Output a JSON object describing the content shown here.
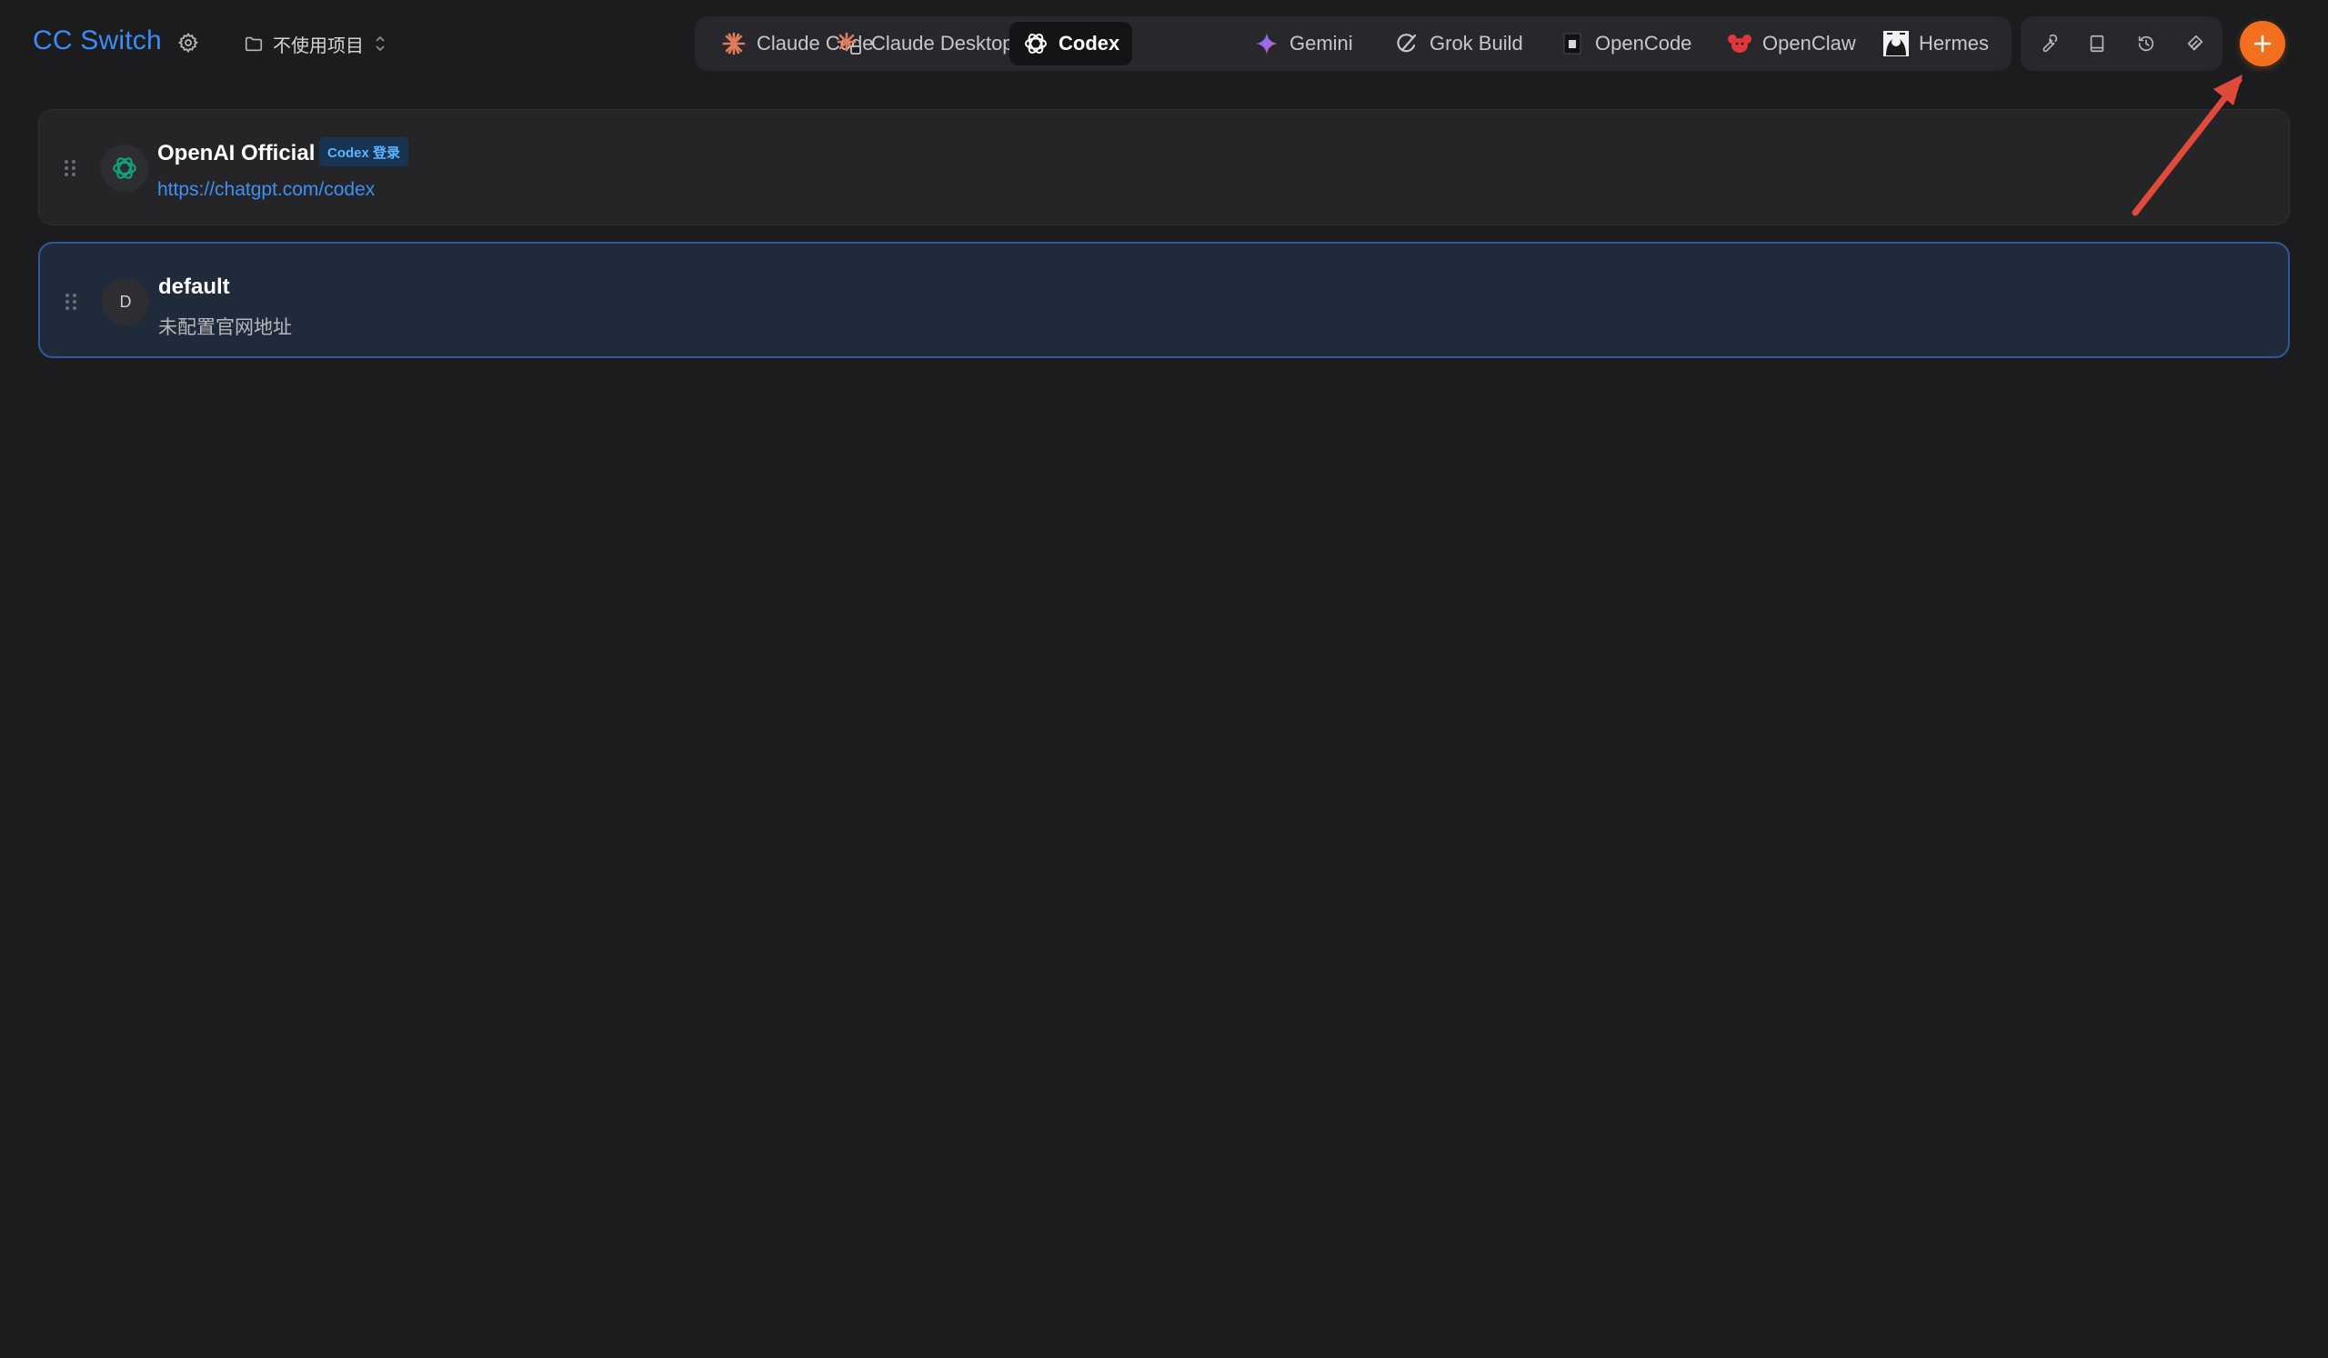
{
  "app": {
    "title": "CC Switch",
    "accent_color": "#3b8cf5",
    "add_button_color": "#f26f1d"
  },
  "header": {
    "settings_icon": "gear-icon",
    "project_selector": {
      "icon": "folder-icon",
      "value": "不使用项目",
      "caret_icon": "chevron-up-down-icon"
    }
  },
  "tabs": [
    {
      "label": "Claude Code",
      "icon": "claude-code-icon",
      "active": false
    },
    {
      "label": "Claude Desktop",
      "icon": "claude-desktop-icon",
      "active": false
    },
    {
      "label": "Codex",
      "icon": "openai-icon",
      "active": true
    },
    {
      "label": "Gemini",
      "icon": "gemini-icon",
      "active": false
    },
    {
      "label": "Grok Build",
      "icon": "grok-icon",
      "active": false
    },
    {
      "label": "OpenCode",
      "icon": "opencode-icon",
      "active": false
    },
    {
      "label": "OpenClaw",
      "icon": "openclaw-icon",
      "active": false
    },
    {
      "label": "Hermes",
      "icon": "hermes-icon",
      "active": false
    }
  ],
  "tools": [
    "wrench-icon",
    "book-icon",
    "history-icon",
    "layers-icon"
  ],
  "add_button": {
    "icon": "plus-icon"
  },
  "providers": [
    {
      "name": "OpenAI Official",
      "badge": "Codex 登录",
      "url": "https://chatgpt.com/codex",
      "avatar_icon": "openai-icon",
      "selected": false
    },
    {
      "name": "default",
      "avatar_letter": "D",
      "subtitle": "未配置官网地址",
      "selected": true
    }
  ]
}
